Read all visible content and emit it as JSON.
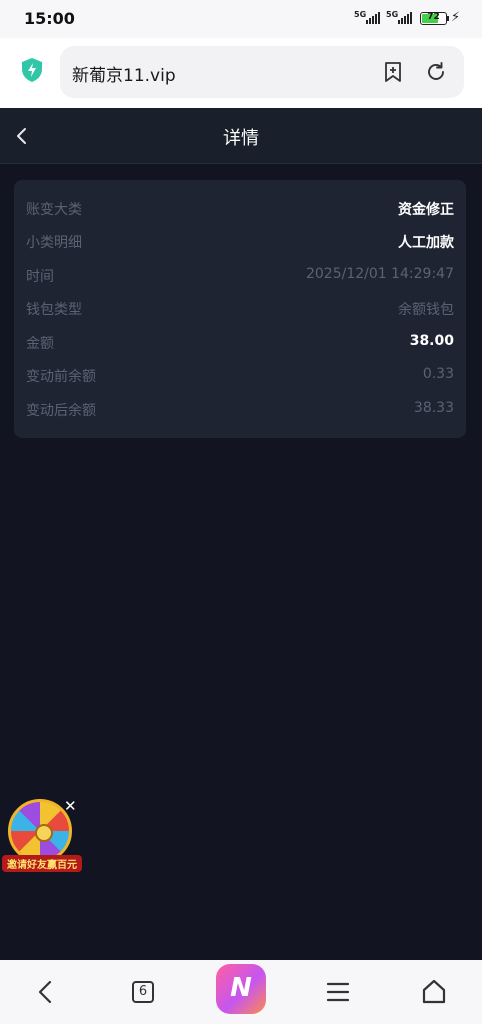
{
  "status_bar": {
    "time": "15:00",
    "signal1": "5G",
    "signal2": "5G",
    "battery": 72
  },
  "browser": {
    "url": "新葡京11.vip",
    "accent": "#2fc7a8"
  },
  "header": {
    "title": "详情"
  },
  "details": [
    {
      "label": "账变大类",
      "value": "资金修正",
      "strong": true
    },
    {
      "label": "小类明细",
      "value": "人工加款",
      "strong": true
    },
    {
      "label": "时间",
      "value": "2025/12/01 14:29:47",
      "strong": false
    },
    {
      "label": "钱包类型",
      "value": "余额钱包",
      "strong": false
    },
    {
      "label": "金额",
      "value": "38.00",
      "strong": true
    },
    {
      "label": "变动前余额",
      "value": "0.33",
      "strong": false
    },
    {
      "label": "变动后余额",
      "value": "38.33",
      "strong": false
    }
  ],
  "promo": {
    "text": "邀请好友赢百元",
    "close": "✕"
  },
  "bottom_nav": {
    "tab_count": "6",
    "app_letter": "N"
  }
}
